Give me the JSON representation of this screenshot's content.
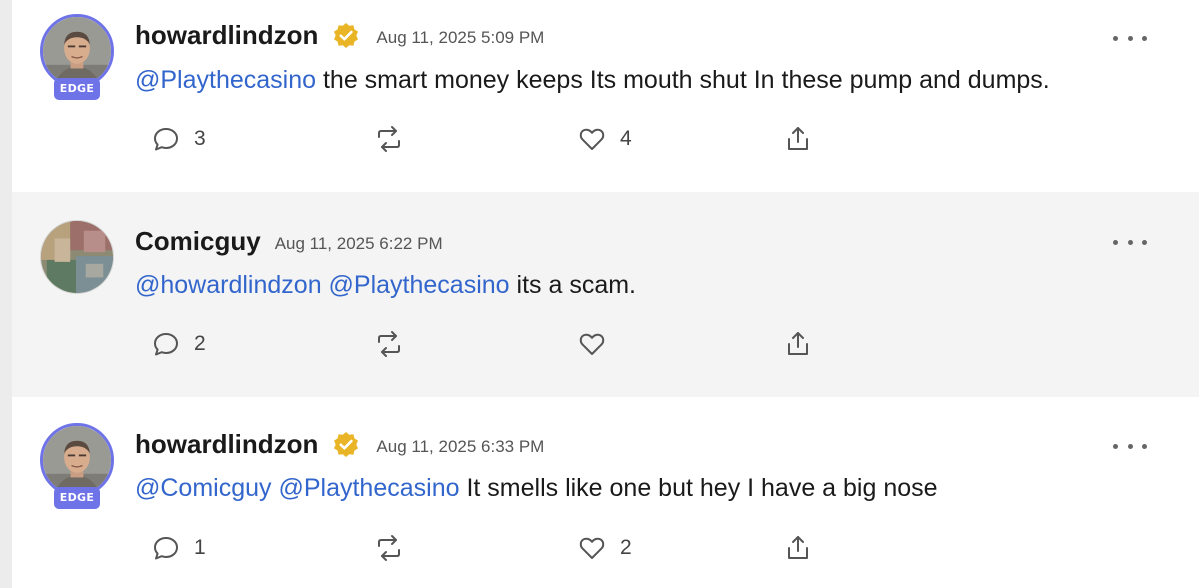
{
  "posts": [
    {
      "username": "howardlindzon",
      "verified": true,
      "badge": "EDGE",
      "timestamp": "Aug 11, 2025 5:09 PM",
      "mentions": "@Playthecasino",
      "text": " the smart money keeps Its mouth shut In these pump and dumps.",
      "replies": "3",
      "reshares": "",
      "likes": "4"
    },
    {
      "username": "Comicguy",
      "verified": false,
      "badge": "",
      "timestamp": "Aug 11, 2025 6:22 PM",
      "mentions": "@howardlindzon @Playthecasino",
      "text": " its a scam.",
      "replies": "2",
      "reshares": "",
      "likes": ""
    },
    {
      "username": "howardlindzon",
      "verified": true,
      "badge": "EDGE",
      "timestamp": "Aug 11, 2025 6:33 PM",
      "mentions": "@Comicguy @Playthecasino",
      "text": " It smells like one but hey I have a big nose",
      "replies": "1",
      "reshares": "",
      "likes": "2"
    }
  ],
  "icons": {
    "reply": "speech-bubble-icon",
    "reshare": "repost-arrows-icon",
    "like": "heart-icon",
    "share": "share-upload-icon",
    "more": "ellipsis-icon",
    "verified": "verified-badge-icon"
  },
  "colors": {
    "mention": "#3366cc",
    "edge_badge": "#6f73e8",
    "verified_badge": "#e9b526",
    "alt_row_background": "#f4f4f4"
  }
}
